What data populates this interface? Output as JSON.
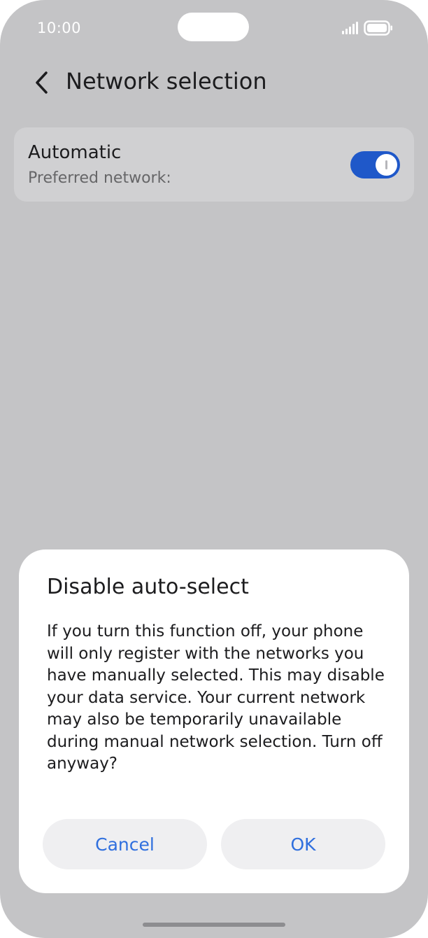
{
  "status_bar": {
    "time": "10:00",
    "icons": [
      "signal-icon",
      "battery-icon"
    ]
  },
  "header": {
    "back_icon": "chevron-left-icon",
    "title": "Network selection"
  },
  "setting": {
    "title": "Automatic",
    "subtitle": "Preferred network:",
    "toggle_on": true,
    "toggle_color": "#1f58c9"
  },
  "dialog": {
    "title": "Disable auto-select",
    "message": "If you turn this function off, your phone will only register with the networks you have manually selected. This may disable your data service. Your current network may also be temporarily unavailable during manual network selection. Turn off anyway?",
    "cancel_label": "Cancel",
    "ok_label": "OK",
    "button_text_color": "#2f6fde"
  }
}
